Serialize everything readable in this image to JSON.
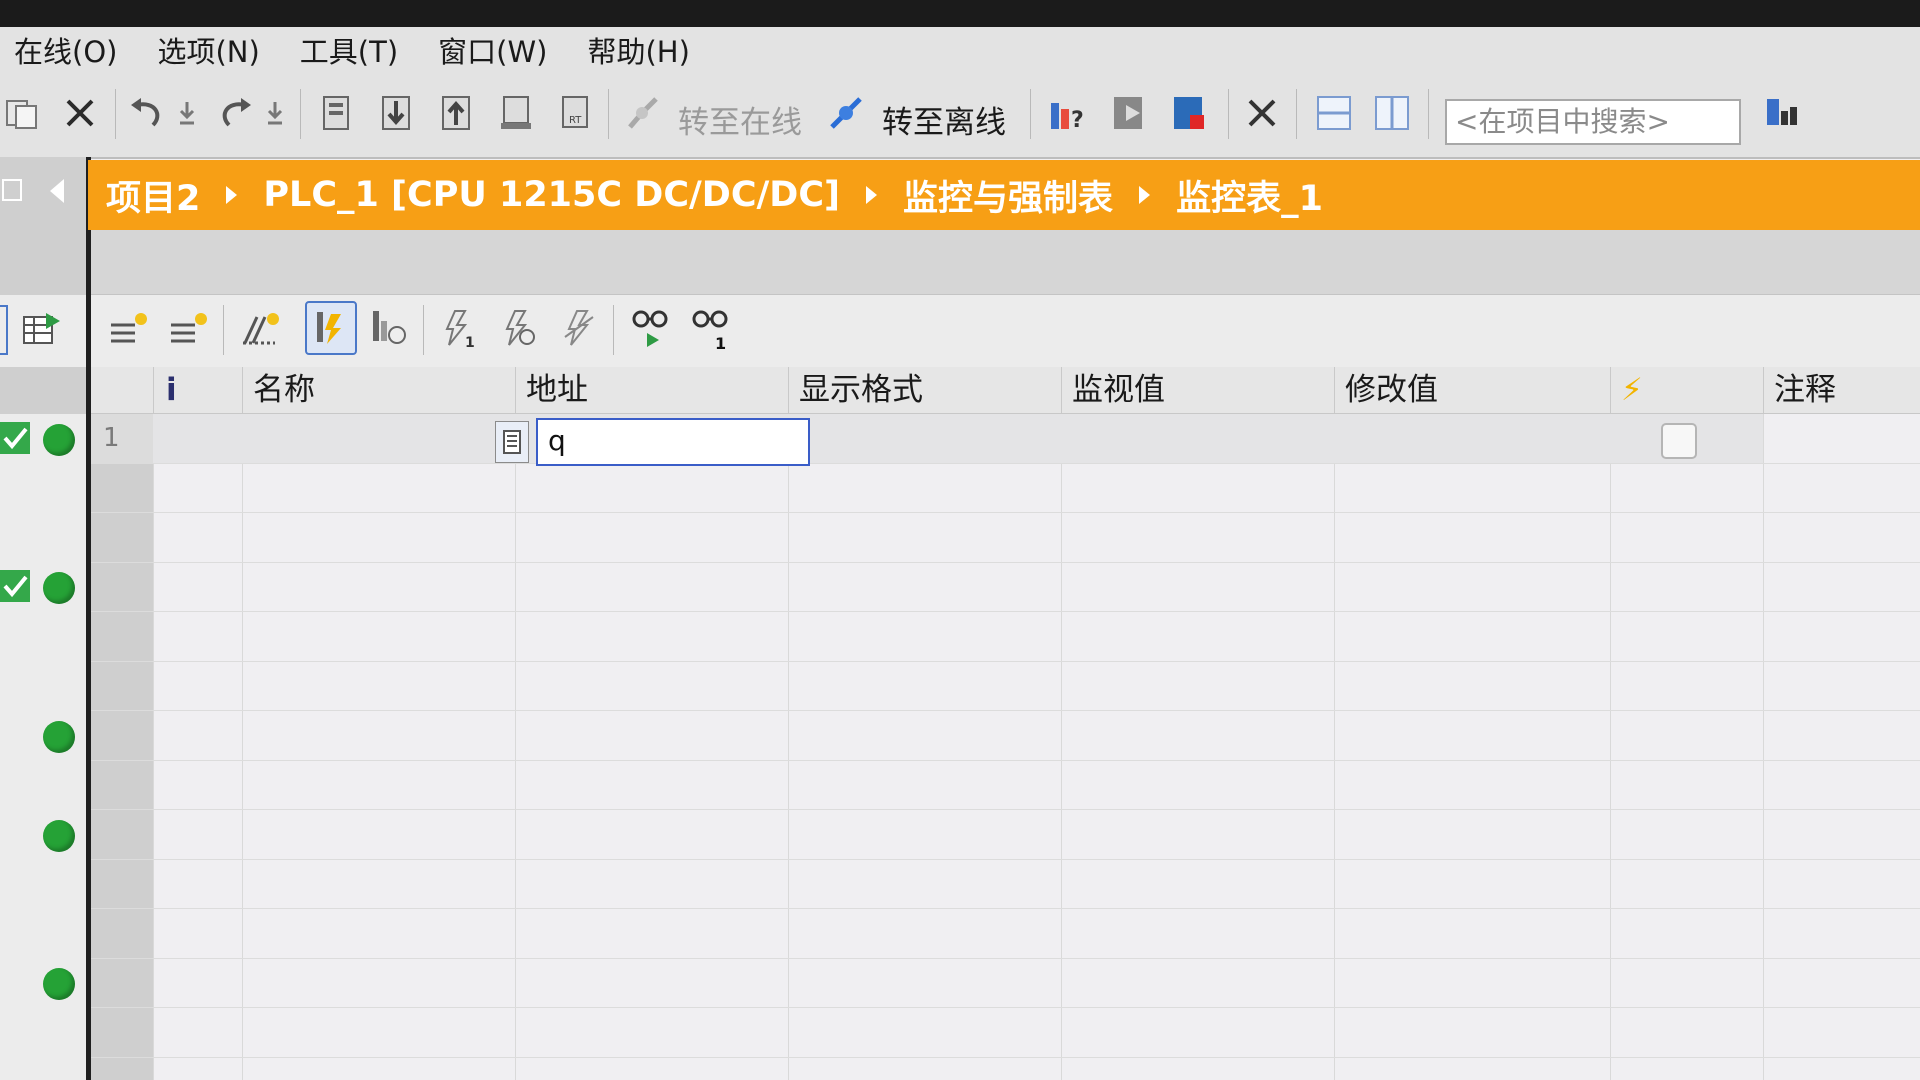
{
  "menu": {
    "items": [
      "在线(O)",
      "选项(N)",
      "工具(T)",
      "窗口(W)",
      "帮助(H)"
    ]
  },
  "toolbar": {
    "go_online_label": "转至在线",
    "go_offline_label": "转至离线",
    "search_placeholder": "<在项目中搜索>"
  },
  "breadcrumb": {
    "items": [
      "项目2",
      "PLC_1 [CPU 1215C DC/DC/DC]",
      "监控与强制表",
      "监控表_1"
    ]
  },
  "table": {
    "columns": {
      "info": "i",
      "name": "名称",
      "address": "地址",
      "display_format": "显示格式",
      "monitor_value": "监视值",
      "modify_value": "修改值",
      "force": "⚡",
      "comment": "注释"
    },
    "rows": [
      {
        "number": "1",
        "name": "",
        "address_input": "q",
        "display_format": "",
        "monitor_value": "",
        "modify_value": "",
        "checkbox": false,
        "comment": ""
      }
    ]
  },
  "colors": {
    "breadcrumb_bg": "#f79f15",
    "status_green": "#25a236",
    "input_border": "#3a5dc8"
  }
}
